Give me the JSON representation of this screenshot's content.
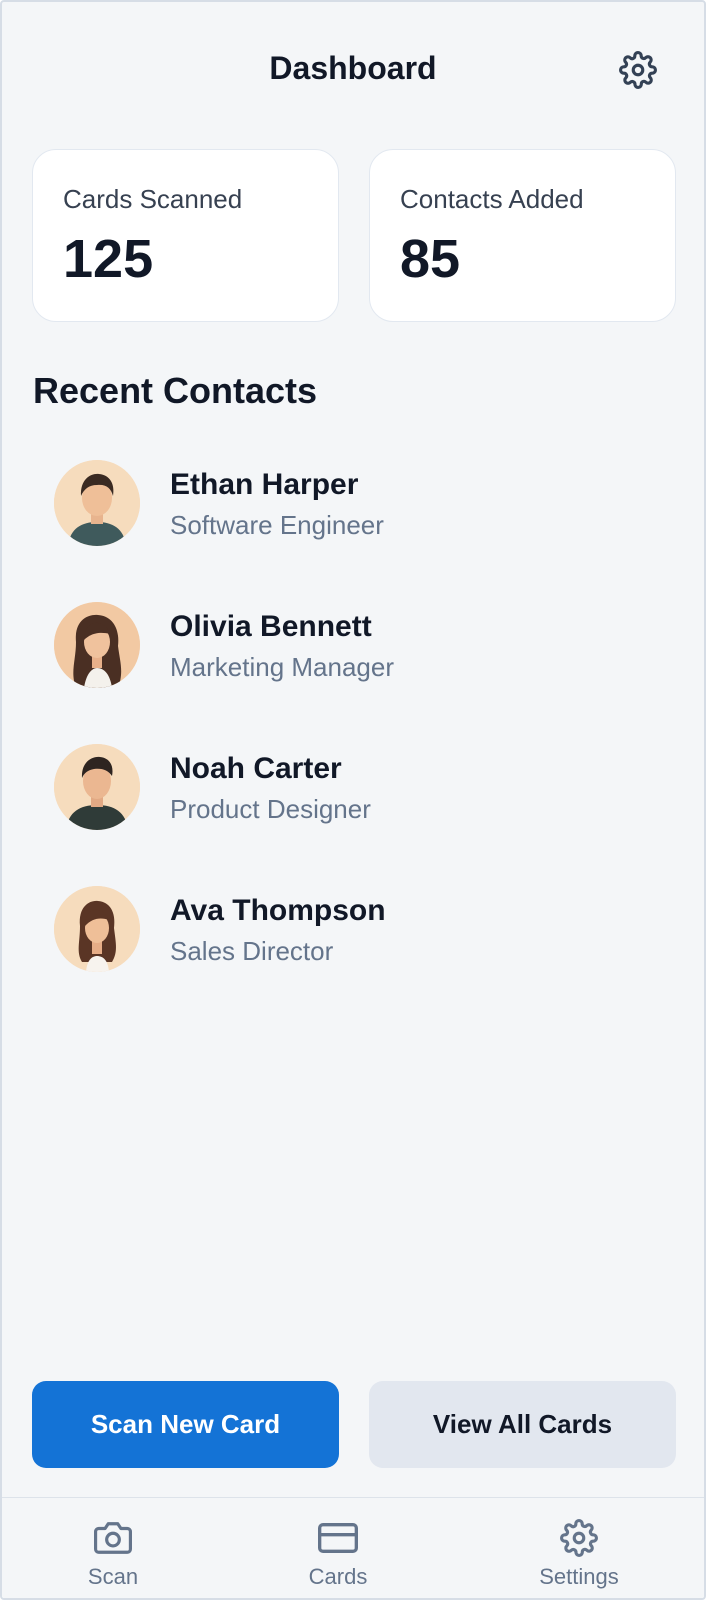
{
  "header": {
    "title": "Dashboard",
    "settings_icon": "gear-icon"
  },
  "stats": [
    {
      "label": "Cards Scanned",
      "value": "125"
    },
    {
      "label": "Contacts Added",
      "value": "85"
    }
  ],
  "recent": {
    "title": "Recent Contacts",
    "contacts": [
      {
        "name": "Ethan Harper",
        "role": "Software Engineer"
      },
      {
        "name": "Olivia Bennett",
        "role": "Marketing Manager"
      },
      {
        "name": "Noah Carter",
        "role": "Product Designer"
      },
      {
        "name": "Ava Thompson",
        "role": "Sales Director"
      }
    ]
  },
  "actions": {
    "primary": "Scan New Card",
    "secondary": "View All Cards"
  },
  "nav": [
    {
      "label": "Scan",
      "icon": "camera-icon"
    },
    {
      "label": "Cards",
      "icon": "card-icon"
    },
    {
      "label": "Settings",
      "icon": "gear-icon"
    }
  ],
  "colors": {
    "primary": "#1473d6",
    "background": "#f4f6f8",
    "text": "#111827",
    "muted": "#64748b"
  }
}
